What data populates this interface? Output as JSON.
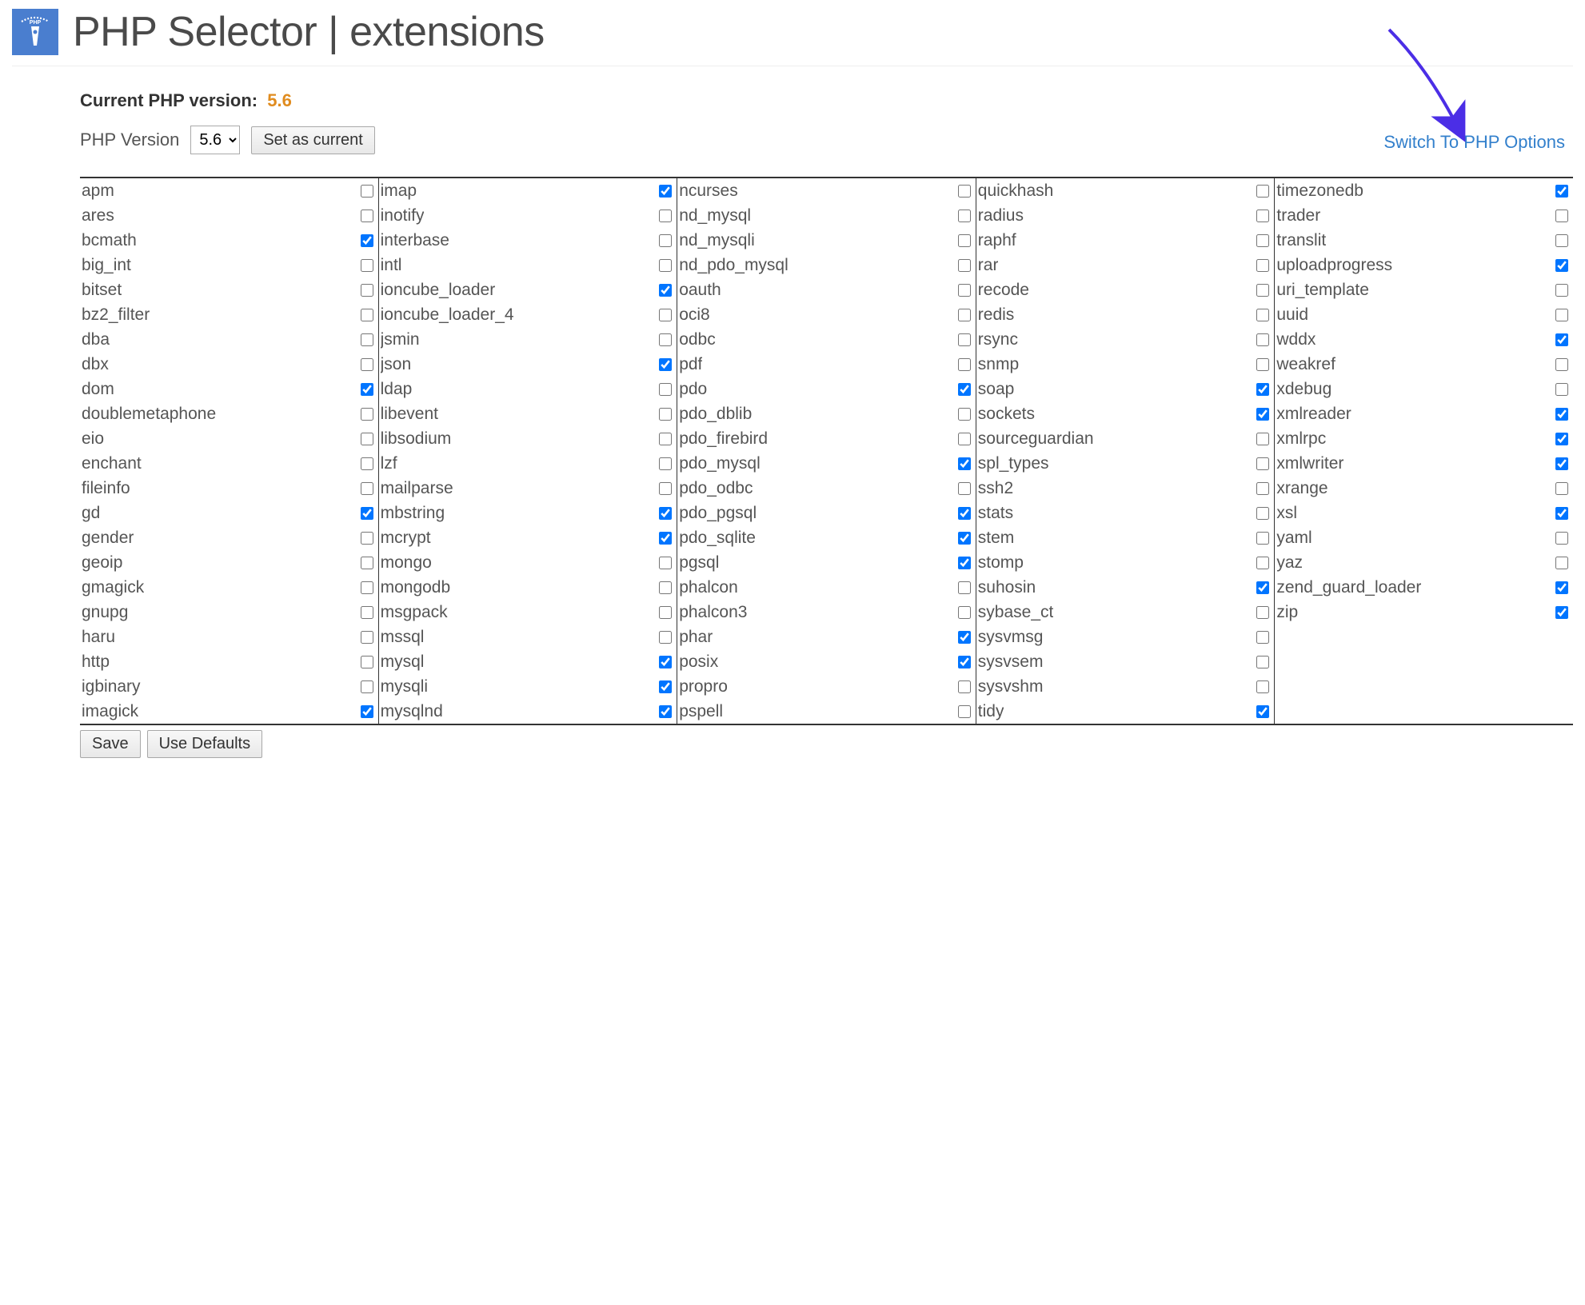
{
  "header": {
    "title": "PHP Selector | extensions"
  },
  "current_version": {
    "label": "Current PHP version:",
    "value": "5.6"
  },
  "version_selector": {
    "label": "PHP Version",
    "selected": "5.6",
    "set_button": "Set as current"
  },
  "options_link": "Switch To PHP Options",
  "extensions": {
    "columns": [
      [
        {
          "name": "apm",
          "checked": false
        },
        {
          "name": "ares",
          "checked": false
        },
        {
          "name": "bcmath",
          "checked": true
        },
        {
          "name": "big_int",
          "checked": false
        },
        {
          "name": "bitset",
          "checked": false
        },
        {
          "name": "bz2_filter",
          "checked": false
        },
        {
          "name": "dba",
          "checked": false
        },
        {
          "name": "dbx",
          "checked": false
        },
        {
          "name": "dom",
          "checked": true
        },
        {
          "name": "doublemetaphone",
          "checked": false
        },
        {
          "name": "eio",
          "checked": false
        },
        {
          "name": "enchant",
          "checked": false
        },
        {
          "name": "fileinfo",
          "checked": false
        },
        {
          "name": "gd",
          "checked": true
        },
        {
          "name": "gender",
          "checked": false
        },
        {
          "name": "geoip",
          "checked": false
        },
        {
          "name": "gmagick",
          "checked": false
        },
        {
          "name": "gnupg",
          "checked": false
        },
        {
          "name": "haru",
          "checked": false
        },
        {
          "name": "http",
          "checked": false
        },
        {
          "name": "igbinary",
          "checked": false
        },
        {
          "name": "imagick",
          "checked": true
        }
      ],
      [
        {
          "name": "imap",
          "checked": true
        },
        {
          "name": "inotify",
          "checked": false
        },
        {
          "name": "interbase",
          "checked": false
        },
        {
          "name": "intl",
          "checked": false
        },
        {
          "name": "ioncube_loader",
          "checked": true
        },
        {
          "name": "ioncube_loader_4",
          "checked": false
        },
        {
          "name": "jsmin",
          "checked": false
        },
        {
          "name": "json",
          "checked": true
        },
        {
          "name": "ldap",
          "checked": false
        },
        {
          "name": "libevent",
          "checked": false
        },
        {
          "name": "libsodium",
          "checked": false
        },
        {
          "name": "lzf",
          "checked": false
        },
        {
          "name": "mailparse",
          "checked": false
        },
        {
          "name": "mbstring",
          "checked": true
        },
        {
          "name": "mcrypt",
          "checked": true
        },
        {
          "name": "mongo",
          "checked": false
        },
        {
          "name": "mongodb",
          "checked": false
        },
        {
          "name": "msgpack",
          "checked": false
        },
        {
          "name": "mssql",
          "checked": false
        },
        {
          "name": "mysql",
          "checked": true
        },
        {
          "name": "mysqli",
          "checked": true
        },
        {
          "name": "mysqlnd",
          "checked": true
        }
      ],
      [
        {
          "name": "ncurses",
          "checked": false
        },
        {
          "name": "nd_mysql",
          "checked": false
        },
        {
          "name": "nd_mysqli",
          "checked": false
        },
        {
          "name": "nd_pdo_mysql",
          "checked": false
        },
        {
          "name": "oauth",
          "checked": false
        },
        {
          "name": "oci8",
          "checked": false
        },
        {
          "name": "odbc",
          "checked": false
        },
        {
          "name": "pdf",
          "checked": false
        },
        {
          "name": "pdo",
          "checked": true
        },
        {
          "name": "pdo_dblib",
          "checked": false
        },
        {
          "name": "pdo_firebird",
          "checked": false
        },
        {
          "name": "pdo_mysql",
          "checked": true
        },
        {
          "name": "pdo_odbc",
          "checked": false
        },
        {
          "name": "pdo_pgsql",
          "checked": true
        },
        {
          "name": "pdo_sqlite",
          "checked": true
        },
        {
          "name": "pgsql",
          "checked": true
        },
        {
          "name": "phalcon",
          "checked": false
        },
        {
          "name": "phalcon3",
          "checked": false
        },
        {
          "name": "phar",
          "checked": true
        },
        {
          "name": "posix",
          "checked": true
        },
        {
          "name": "propro",
          "checked": false
        },
        {
          "name": "pspell",
          "checked": false
        }
      ],
      [
        {
          "name": "quickhash",
          "checked": false
        },
        {
          "name": "radius",
          "checked": false
        },
        {
          "name": "raphf",
          "checked": false
        },
        {
          "name": "rar",
          "checked": false
        },
        {
          "name": "recode",
          "checked": false
        },
        {
          "name": "redis",
          "checked": false
        },
        {
          "name": "rsync",
          "checked": false
        },
        {
          "name": "snmp",
          "checked": false
        },
        {
          "name": "soap",
          "checked": true
        },
        {
          "name": "sockets",
          "checked": true
        },
        {
          "name": "sourceguardian",
          "checked": false
        },
        {
          "name": "spl_types",
          "checked": false
        },
        {
          "name": "ssh2",
          "checked": false
        },
        {
          "name": "stats",
          "checked": false
        },
        {
          "name": "stem",
          "checked": false
        },
        {
          "name": "stomp",
          "checked": false
        },
        {
          "name": "suhosin",
          "checked": true
        },
        {
          "name": "sybase_ct",
          "checked": false
        },
        {
          "name": "sysvmsg",
          "checked": false
        },
        {
          "name": "sysvsem",
          "checked": false
        },
        {
          "name": "sysvshm",
          "checked": false
        },
        {
          "name": "tidy",
          "checked": true
        }
      ],
      [
        {
          "name": "timezonedb",
          "checked": true
        },
        {
          "name": "trader",
          "checked": false
        },
        {
          "name": "translit",
          "checked": false
        },
        {
          "name": "uploadprogress",
          "checked": true
        },
        {
          "name": "uri_template",
          "checked": false
        },
        {
          "name": "uuid",
          "checked": false
        },
        {
          "name": "wddx",
          "checked": true
        },
        {
          "name": "weakref",
          "checked": false
        },
        {
          "name": "xdebug",
          "checked": false
        },
        {
          "name": "xmlreader",
          "checked": true
        },
        {
          "name": "xmlrpc",
          "checked": true
        },
        {
          "name": "xmlwriter",
          "checked": true
        },
        {
          "name": "xrange",
          "checked": false
        },
        {
          "name": "xsl",
          "checked": true
        },
        {
          "name": "yaml",
          "checked": false
        },
        {
          "name": "yaz",
          "checked": false
        },
        {
          "name": "zend_guard_loader",
          "checked": true
        },
        {
          "name": "zip",
          "checked": true
        }
      ]
    ]
  },
  "actions": {
    "save": "Save",
    "defaults": "Use Defaults"
  }
}
